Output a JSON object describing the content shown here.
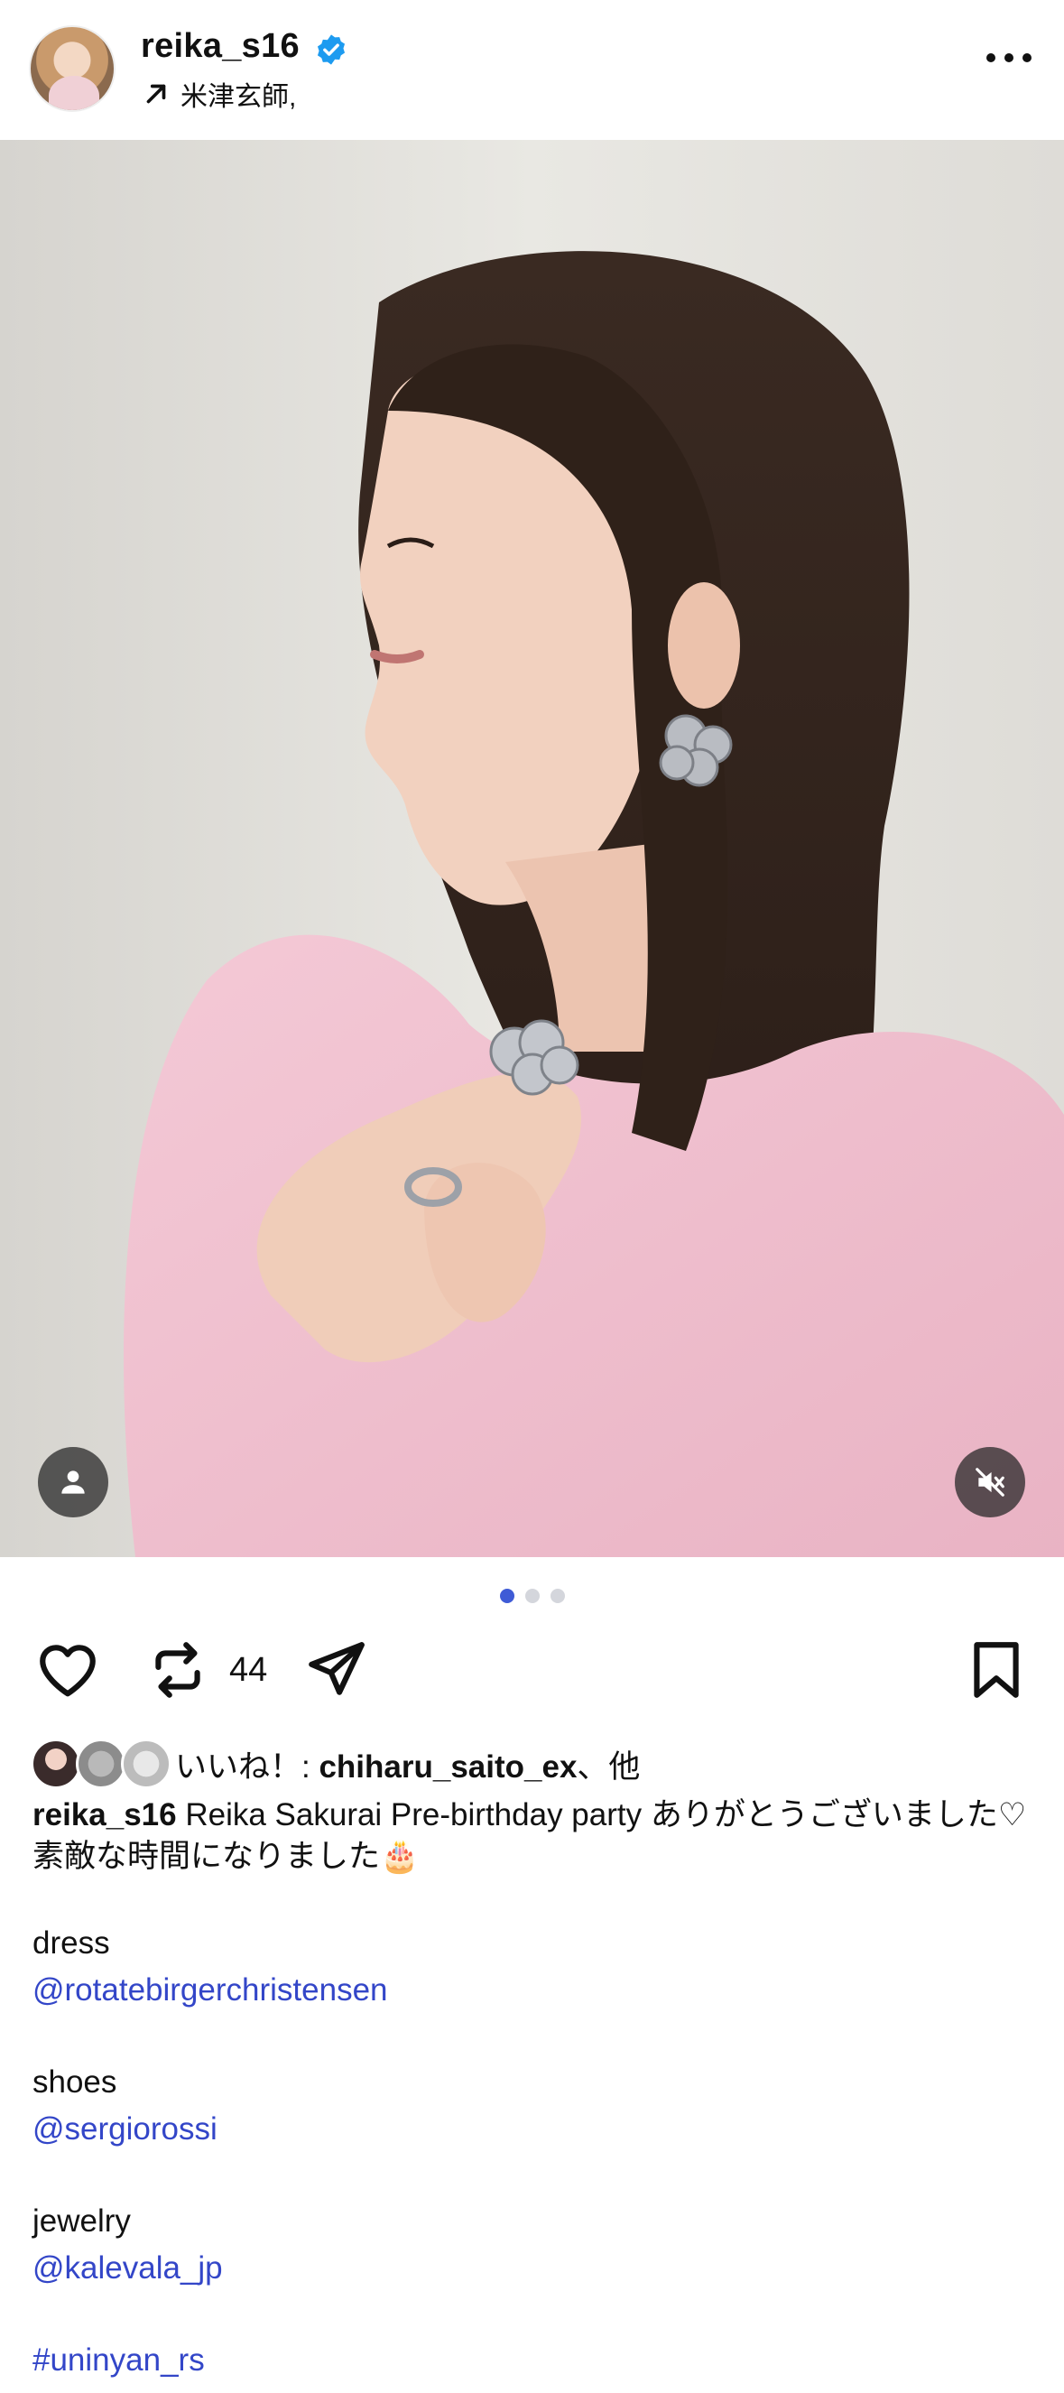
{
  "post": {
    "username": "reika_s16",
    "verified": true,
    "location": "米津玄師,"
  },
  "photo": {
    "page_count": 3,
    "active_page": 1
  },
  "actions": {
    "repost_count": "44"
  },
  "likes": {
    "prefix": "いいね！: ",
    "user": "chiharu_saito_ex",
    "suffix": "、他"
  },
  "caption": {
    "username": "reika_s16",
    "text": " Reika Sakurai Pre-birthday party ありがとうございました♡素敵な時間になりました🎂",
    "dress_label": "dress",
    "dress_link": "@rotatebirgerchristensen",
    "shoes_label": "shoes",
    "shoes_link": "@sergiorossi",
    "jewelry_label": "jewelry",
    "jewelry_link": "@kalevala_jp",
    "hashtag": "#uninyan_rs"
  },
  "colors": {
    "link": "#3346c8",
    "active_dot": "#3f5bd6",
    "verified": "#1d9bf0"
  },
  "icons": [
    "verified-icon",
    "arrow-up-right-icon",
    "more-icon",
    "person-tag-icon",
    "mute-icon",
    "heart-icon",
    "repost-icon",
    "share-icon",
    "bookmark-icon"
  ]
}
